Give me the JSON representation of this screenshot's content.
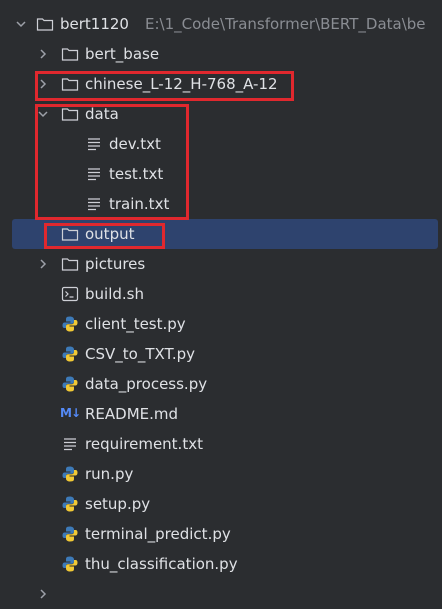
{
  "root": {
    "name": "bert1120",
    "path": "E:\\1_Code\\Transformer\\BERT_Data\\be"
  },
  "items": [
    {
      "label": "bert_base",
      "type": "folder"
    },
    {
      "label": "chinese_L-12_H-768_A-12",
      "type": "folder"
    },
    {
      "label": "data",
      "type": "folder"
    },
    {
      "label": "dev.txt",
      "type": "text-file"
    },
    {
      "label": "test.txt",
      "type": "text-file"
    },
    {
      "label": "train.txt",
      "type": "text-file"
    },
    {
      "label": "output",
      "type": "folder"
    },
    {
      "label": "pictures",
      "type": "folder"
    },
    {
      "label": "build.sh",
      "type": "shell-file"
    },
    {
      "label": "client_test.py",
      "type": "python-file"
    },
    {
      "label": "CSV_to_TXT.py",
      "type": "python-file"
    },
    {
      "label": "data_process.py",
      "type": "python-file"
    },
    {
      "label": "README.md",
      "type": "markdown-file"
    },
    {
      "label": "requirement.txt",
      "type": "text-file"
    },
    {
      "label": "run.py",
      "type": "python-file"
    },
    {
      "label": "setup.py",
      "type": "python-file"
    },
    {
      "label": "terminal_predict.py",
      "type": "python-file"
    },
    {
      "label": "thu_classification.py",
      "type": "python-file"
    }
  ],
  "icons": {
    "markdown_glyph": "M↓"
  },
  "colors": {
    "background": "#2b2d30",
    "selection": "#2e436e",
    "highlight_box": "#e0282e",
    "text": "#dfe1e5",
    "path_text": "#8a8d93"
  }
}
